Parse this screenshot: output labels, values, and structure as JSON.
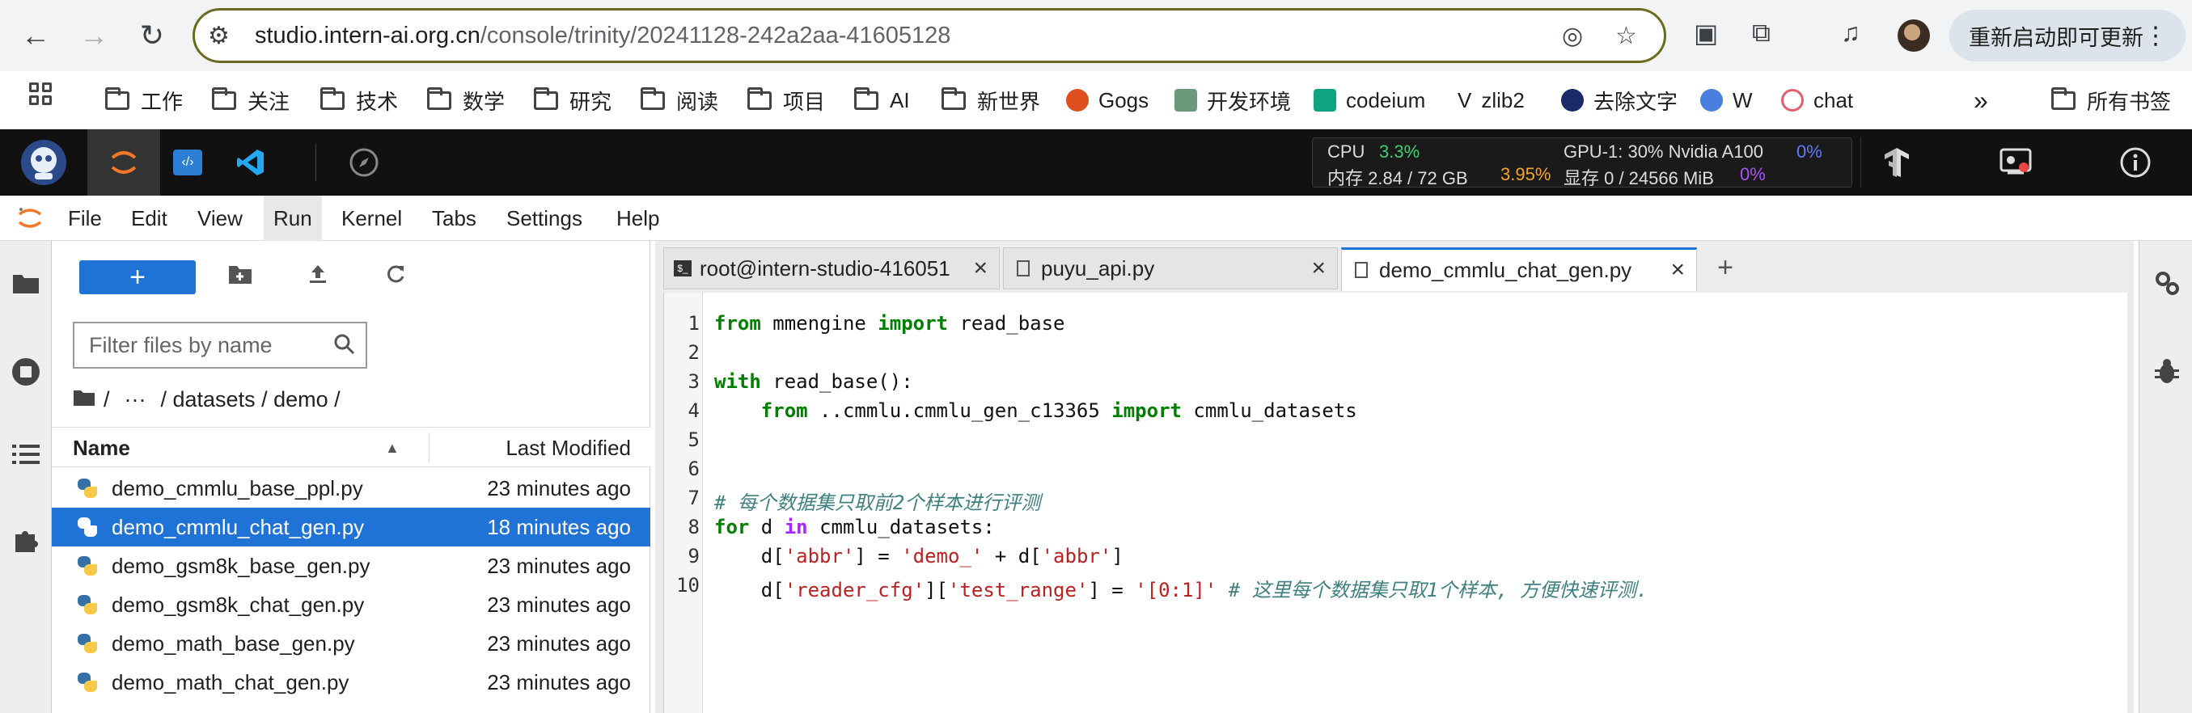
{
  "browser": {
    "url_host": "studio.intern-ai.org.cn",
    "url_path": "/console/trinity/20241128-242a2aa-41605128",
    "update_button": "重新启动即可更新",
    "update_dots": "⋮"
  },
  "bookmarks": [
    {
      "label": "工作",
      "type": "folder"
    },
    {
      "label": "关注",
      "type": "folder"
    },
    {
      "label": "技术",
      "type": "folder"
    },
    {
      "label": "数学",
      "type": "folder"
    },
    {
      "label": "研究",
      "type": "folder"
    },
    {
      "label": "阅读",
      "type": "folder"
    },
    {
      "label": "项目",
      "type": "folder"
    },
    {
      "label": "AI",
      "type": "folder"
    },
    {
      "label": "新世界",
      "type": "folder"
    },
    {
      "label": "Gogs",
      "type": "site"
    },
    {
      "label": "开发环境",
      "type": "site"
    },
    {
      "label": "codeium",
      "type": "site"
    },
    {
      "label": "zlib2",
      "type": "site"
    },
    {
      "label": "去除文字",
      "type": "site"
    },
    {
      "label": "W",
      "type": "site"
    },
    {
      "label": "chat",
      "type": "site"
    },
    {
      "label": "»",
      "type": "more"
    },
    {
      "label": "所有书签",
      "type": "folder"
    }
  ],
  "monitor": {
    "cpu_label": "CPU",
    "cpu_value": "3.3%",
    "mem_label": "内存 2.84 / 72 GB",
    "mem_value": "3.95%",
    "gpu_label": "GPU-1: 30% Nvidia A100",
    "gpu_value": "0%",
    "vram_label": "显存 0 / 24566 MiB",
    "vram_value": "0%"
  },
  "menu": [
    "File",
    "Edit",
    "View",
    "Run",
    "Kernel",
    "Tabs",
    "Settings",
    "Help"
  ],
  "menu_active": "Run",
  "filebrowser": {
    "new_label": "+",
    "filter_placeholder": "Filter files by name",
    "breadcrumb_root": "/",
    "breadcrumb_more": "···",
    "breadcrumb_path": "/ datasets / demo /",
    "col_name": "Name",
    "col_modified": "Last Modified",
    "files": [
      {
        "name": "demo_cmmlu_base_ppl.py",
        "modified": "23 minutes ago",
        "selected": false
      },
      {
        "name": "demo_cmmlu_chat_gen.py",
        "modified": "18 minutes ago",
        "selected": true
      },
      {
        "name": "demo_gsm8k_base_gen.py",
        "modified": "23 minutes ago",
        "selected": false
      },
      {
        "name": "demo_gsm8k_chat_gen.py",
        "modified": "23 minutes ago",
        "selected": false
      },
      {
        "name": "demo_math_base_gen.py",
        "modified": "23 minutes ago",
        "selected": false
      },
      {
        "name": "demo_math_chat_gen.py",
        "modified": "23 minutes ago",
        "selected": false
      }
    ]
  },
  "tabs": [
    {
      "label": "root@intern-studio-416051",
      "icon": "terminal-icon"
    },
    {
      "label": "puyu_api.py",
      "icon": "file-icon"
    },
    {
      "label": "demo_cmmlu_chat_gen.py",
      "icon": "file-icon",
      "active": true
    }
  ],
  "code_lines": [
    "1",
    "2",
    "3",
    "4",
    "5",
    "6",
    "7",
    "8",
    "9",
    "10"
  ],
  "code": {
    "l1": {
      "kw1": "from",
      "t1": " mmengine ",
      "kw2": "import",
      "t2": " read_base"
    },
    "l3": {
      "kw1": "with",
      "t1": " read_base():"
    },
    "l4": {
      "ind": "    ",
      "kw1": "from",
      "t1": " ..cmmlu.cmmlu_gen_c13365 ",
      "kw2": "import",
      "t2": " cmmlu_datasets"
    },
    "l7": {
      "cm": "# 每个数据集只取前2个样本进行评测"
    },
    "l8": {
      "kw1": "for",
      "t1": " d ",
      "kw2": "in",
      "t2": " cmmlu_datasets:"
    },
    "l9": {
      "ind": "    ",
      "t1": "d[",
      "s1": "'abbr'",
      "t2": "] = ",
      "s2": "'demo_'",
      "t3": " + d[",
      "s3": "'abbr'",
      "t4": "]"
    },
    "l10": {
      "ind": "    ",
      "t1": "d[",
      "s1": "'reader_cfg'",
      "t2": "][",
      "s2": "'test_range'",
      "t3": "] = ",
      "s3": "'[0:1]'",
      "cm": " # 这里每个数据集只取1个样本, 方便快速评测."
    }
  }
}
